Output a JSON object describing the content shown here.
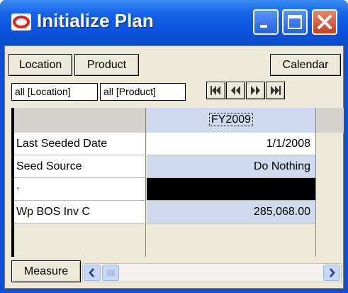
{
  "window": {
    "title": "Initialize Plan",
    "buttons": {
      "minimize": "minimize",
      "maximize": "maximize",
      "close": "close"
    }
  },
  "toolbar": {
    "location_label": "Location",
    "product_label": "Product",
    "calendar_label": "Calendar"
  },
  "filters": {
    "location": "all [Location]",
    "product": "all [Product]"
  },
  "nav_icons": [
    "first-icon",
    "previous-icon",
    "next-icon",
    "last-icon"
  ],
  "grid": {
    "column_header": "FY2009",
    "rows": [
      {
        "label": "Last Seeded Date",
        "value": "1/1/2008"
      },
      {
        "label": "Seed Source",
        "value": "Do Nothing"
      },
      {
        "label": ".",
        "value": ""
      },
      {
        "label": "Wp BOS Inv C",
        "value": "285,068.00"
      }
    ]
  },
  "bottom": {
    "measure_label": "Measure"
  },
  "colors": {
    "titlebar": "#0b52dc",
    "header_blue": "#cfd9ef",
    "close_red": "#c6421f"
  }
}
